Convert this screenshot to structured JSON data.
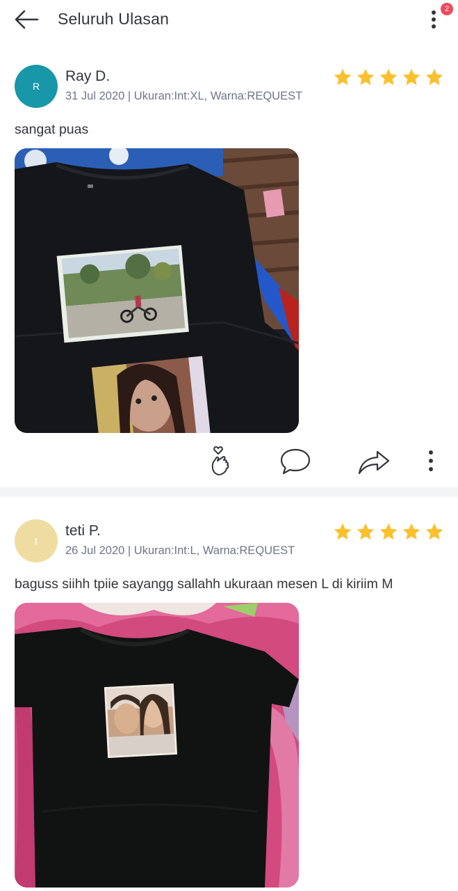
{
  "header": {
    "title": "Seluruh Ulasan",
    "notification_count": "2"
  },
  "reviews": [
    {
      "avatar_letter": "R",
      "avatar_color": "#1897a8",
      "name": "Ray D.",
      "meta": "31 Jul 2020 | Ukuran:Int:XL, Warna:REQUEST",
      "rating": 5,
      "text": "sangat puas"
    },
    {
      "avatar_letter": "t",
      "avatar_color": "#efdca0",
      "name": "teti P.",
      "meta": "26 Jul 2020 | Ukuran:Int:L, Warna:REQUEST",
      "rating": 5,
      "text": "baguss siihh tpiie sayangg sallahh ukuraan mesen L di kiriim M"
    }
  ],
  "colors": {
    "star": "#fbc02d",
    "icon": "#31353b",
    "badge": "#ef4a5c"
  }
}
